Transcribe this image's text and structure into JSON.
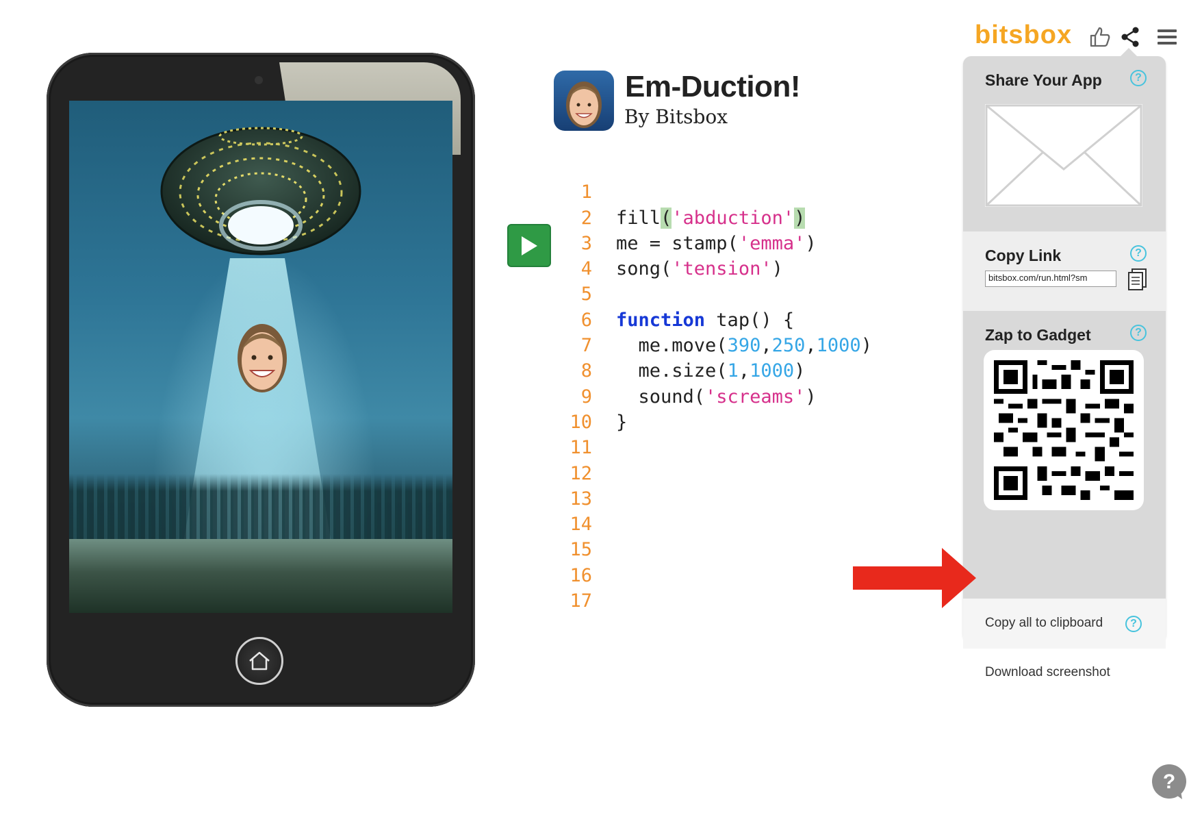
{
  "app": {
    "title": "Em-Duction!",
    "author": "By Bitsbox"
  },
  "code": {
    "lines": [
      {
        "number": "1",
        "text": "fill('abduction')"
      },
      {
        "number": "2",
        "text": "me = stamp('emma')"
      },
      {
        "number": "3",
        "text": "song('tension')"
      },
      {
        "number": "4",
        "text": ""
      },
      {
        "number": "5",
        "text": "function tap() {"
      },
      {
        "number": "6",
        "text": "  me.move(390,250,1000)"
      },
      {
        "number": "7",
        "text": "  me.size(1,1000)"
      },
      {
        "number": "8",
        "text": "  sound('screams')"
      },
      {
        "number": "9",
        "text": "}"
      },
      {
        "number": "10",
        "text": ""
      },
      {
        "number": "11",
        "text": ""
      },
      {
        "number": "12",
        "text": ""
      },
      {
        "number": "13",
        "text": ""
      },
      {
        "number": "14",
        "text": ""
      },
      {
        "number": "15",
        "text": ""
      },
      {
        "number": "16",
        "text": ""
      },
      {
        "number": "17",
        "text": ""
      }
    ]
  },
  "toolbar": {
    "logo": "bitsbox",
    "icons": [
      "thumbs-up-icon",
      "share-icon",
      "hamburger-menu-icon"
    ]
  },
  "share_panel": {
    "share_heading": "Share Your App",
    "copy_link_heading": "Copy Link",
    "copy_link_value": "bitsbox.com/run.html?sm",
    "zap_heading": "Zap to Gadget",
    "copy_all_label": "Copy all to clipboard",
    "download_label": "Download screenshot",
    "help_glyph": "?"
  },
  "help_bubble": {
    "glyph": "?"
  },
  "colors": {
    "brand": "#f5a623",
    "run_button": "#2f9a45",
    "line_numbers": "#f0902e",
    "string": "#d6308b",
    "number": "#35a6e6",
    "keyword": "#1638d6",
    "help_icon": "#47c3dd",
    "arrow": "#e8291c",
    "panel": "#d9d9d9"
  }
}
